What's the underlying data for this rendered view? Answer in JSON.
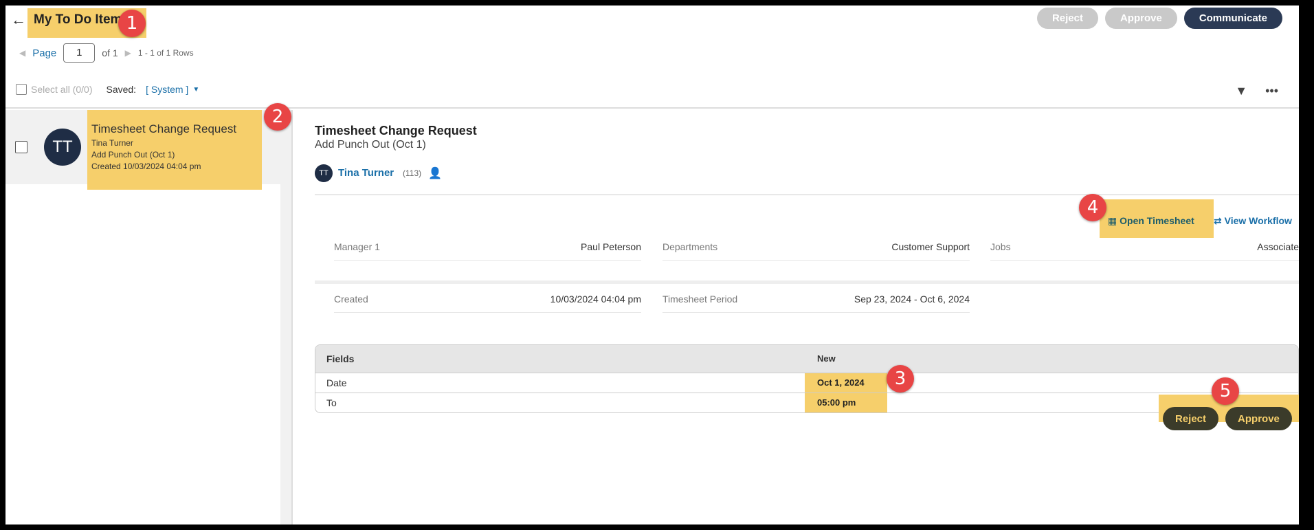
{
  "header": {
    "title": "My To Do Items",
    "actions": {
      "reject": "Reject",
      "approve": "Approve",
      "communicate": "Communicate"
    }
  },
  "pager": {
    "page_label": "Page",
    "page_value": "1",
    "of_text": "of 1",
    "rows_text": "1 - 1 of 1 Rows"
  },
  "toolbar": {
    "select_all": "Select all (0/0)",
    "saved_label": "Saved:",
    "saved_value": "[ System ]"
  },
  "list": {
    "items": [
      {
        "initials": "TT",
        "title": "Timesheet Change Request",
        "person": "Tina Turner",
        "detail": "Add Punch Out (Oct 1)",
        "created": "Created 10/03/2024 04:04 pm"
      }
    ]
  },
  "detail": {
    "title": "Timesheet Change Request",
    "subtitle": "Add Punch Out (Oct 1)",
    "initials": "TT",
    "person": "Tina Turner",
    "person_id": "(113)",
    "links": {
      "open_timesheet": "Open Timesheet",
      "view_workflow": "View Workflow"
    },
    "info_row1": [
      {
        "label": "Manager 1",
        "value": "Paul Peterson"
      },
      {
        "label": "Departments",
        "value": "Customer Support"
      },
      {
        "label": "Jobs",
        "value": "Associate"
      }
    ],
    "info_row2": [
      {
        "label": "Created",
        "value": "10/03/2024 04:04 pm"
      },
      {
        "label": "Timesheet Period",
        "value": "Sep 23, 2024 - Oct 6, 2024"
      }
    ],
    "table": {
      "headers": [
        "Fields",
        "New"
      ],
      "rows": [
        [
          "Date",
          "Oct 1, 2024"
        ],
        [
          "To",
          "05:00 pm"
        ]
      ]
    },
    "bottom_actions": {
      "reject": "Reject",
      "approve": "Approve"
    }
  },
  "annotations": [
    "1",
    "2",
    "3",
    "4",
    "5"
  ],
  "colors": {
    "highlight": "#f6cf6b",
    "badge": "#e84545",
    "accent": "#1a6fa8",
    "dark_button": "#2b3a55",
    "avatar": "#1f2d45"
  }
}
